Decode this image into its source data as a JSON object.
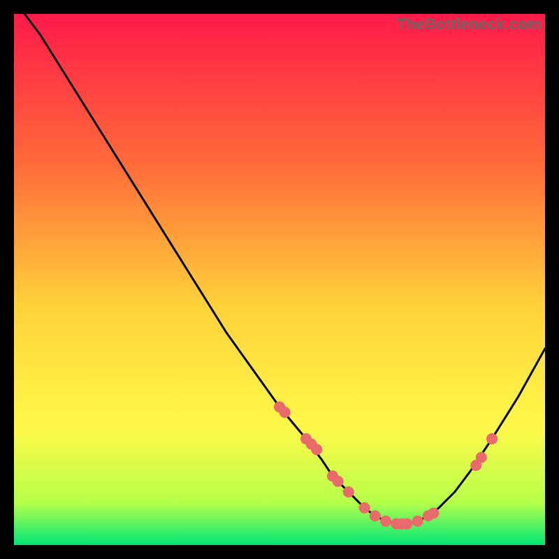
{
  "watermark": "TheBottleneck.com",
  "colors": {
    "gradient_top": "#ff1a4a",
    "gradient_mid_upper": "#ff6a3a",
    "gradient_mid": "#ffd23a",
    "gradient_mid_lower": "#fff94a",
    "gradient_low": "#b6ff4a",
    "gradient_bottom": "#00e676",
    "curve": "#000000",
    "marker": "#e86a6a",
    "frame_bg": "#000000"
  },
  "chart_data": {
    "type": "line",
    "title": "",
    "xlabel": "",
    "ylabel": "",
    "xlim": [
      0,
      100
    ],
    "ylim": [
      0,
      100
    ],
    "series": [
      {
        "name": "bottleneck-curve",
        "x": [
          2,
          5,
          10,
          15,
          20,
          25,
          30,
          35,
          40,
          45,
          50,
          55,
          58,
          60,
          62,
          64,
          66,
          68,
          70,
          72,
          74,
          76,
          78,
          80,
          83,
          86,
          90,
          95,
          100
        ],
        "y": [
          100,
          96,
          88,
          80,
          72,
          64,
          56,
          48,
          40,
          33,
          26,
          20,
          16,
          13,
          11,
          9,
          7,
          5.5,
          4.5,
          4,
          4,
          4.5,
          5.5,
          7,
          10,
          14,
          20,
          28,
          37
        ]
      }
    ],
    "markers": {
      "name": "highlight-points",
      "x": [
        50,
        51,
        55,
        56,
        57,
        60,
        61,
        63,
        66,
        68,
        70,
        72,
        73,
        74,
        76,
        78,
        79,
        87,
        88,
        90
      ],
      "y": [
        26,
        25,
        20,
        19,
        18,
        13,
        12,
        10,
        7,
        5.5,
        4.5,
        4,
        4,
        4,
        4.5,
        5.5,
        6,
        15,
        16.5,
        20
      ]
    }
  }
}
